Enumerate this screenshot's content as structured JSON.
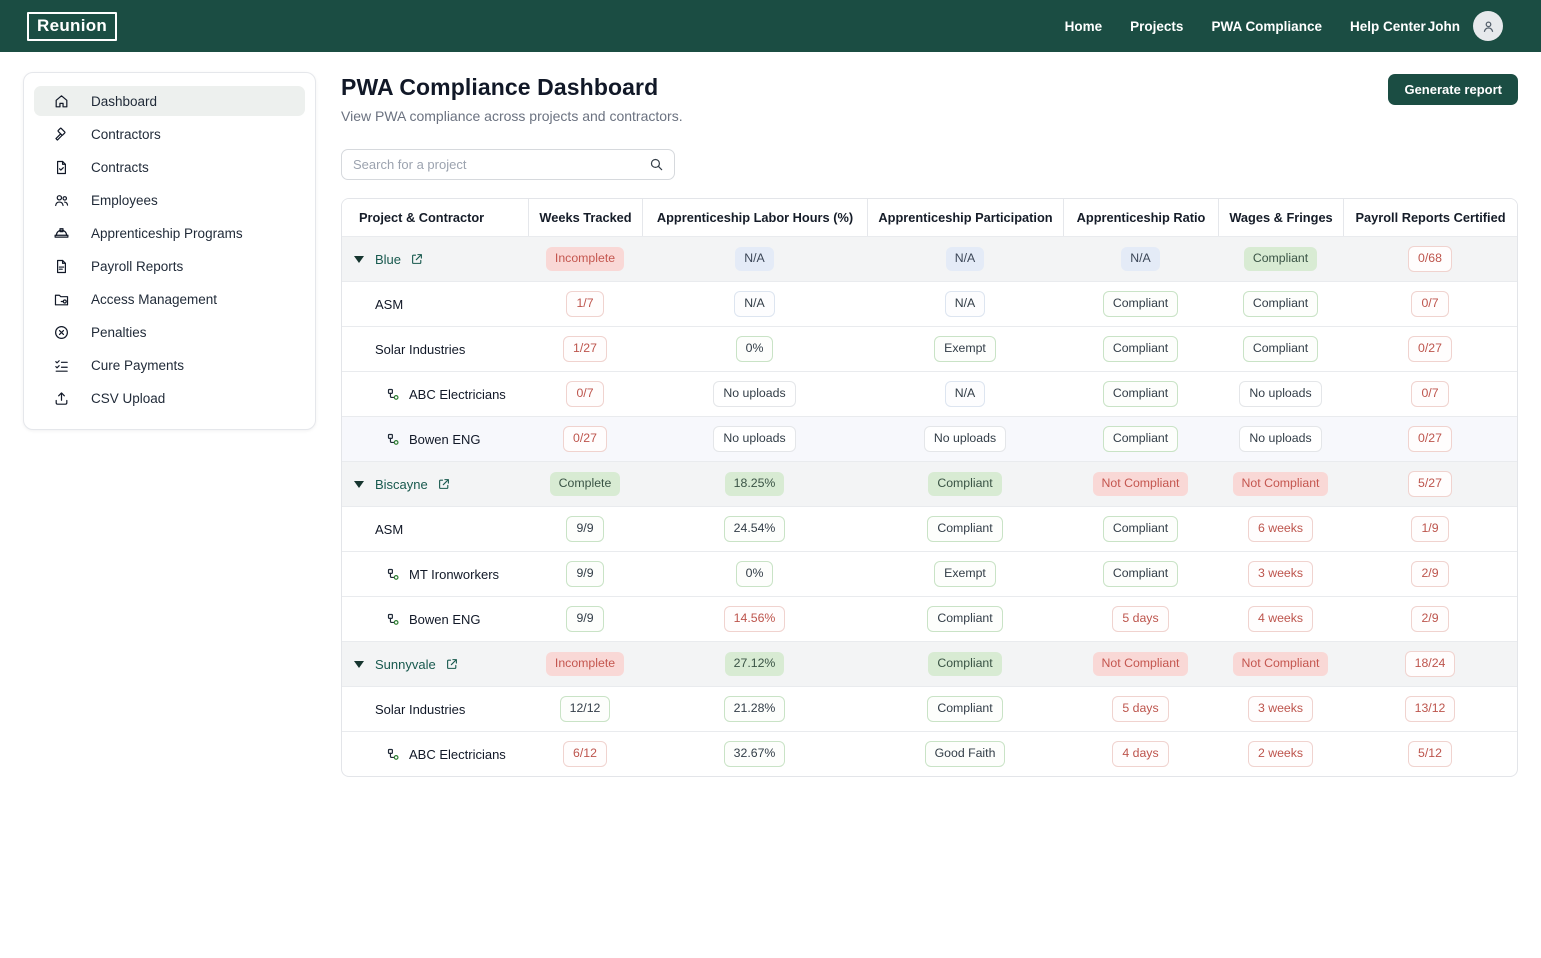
{
  "topbar": {
    "logo": "Reunion",
    "nav": [
      "Home",
      "Projects",
      "PWA Compliance",
      "Help Center"
    ],
    "user": "John"
  },
  "sidebar": {
    "items": [
      {
        "label": "Dashboard",
        "icon": "home-icon",
        "active": true
      },
      {
        "label": "Contractors",
        "icon": "hammer-icon",
        "active": false
      },
      {
        "label": "Contracts",
        "icon": "contract-icon",
        "active": false
      },
      {
        "label": "Employees",
        "icon": "employees-icon",
        "active": false
      },
      {
        "label": "Apprenticeship Programs",
        "icon": "hardhat-icon",
        "active": false
      },
      {
        "label": "Payroll Reports",
        "icon": "payroll-icon",
        "active": false
      },
      {
        "label": "Access Management",
        "icon": "folder-key-icon",
        "active": false
      },
      {
        "label": "Penalties",
        "icon": "penalty-icon",
        "active": false
      },
      {
        "label": "Cure Payments",
        "icon": "checklist-icon",
        "active": false
      },
      {
        "label": "CSV Upload",
        "icon": "upload-icon",
        "active": false
      }
    ]
  },
  "header": {
    "title": "PWA Compliance Dashboard",
    "subtitle": "View PWA compliance across projects and contractors.",
    "generate_report_label": "Generate report",
    "search_placeholder": "Search for a project"
  },
  "table": {
    "columns": [
      "Project & Contractor",
      "Weeks Tracked",
      "Apprenticeship Labor Hours (%)",
      "Apprenticeship Participation",
      "Apprenticeship Ratio",
      "Wages & Fringes",
      "Payroll Reports Certified"
    ],
    "rows": [
      {
        "name": "Blue",
        "level": "project",
        "tint": false,
        "cells": [
          {
            "text": "Incomplete",
            "style": "fill-red"
          },
          {
            "text": "N/A",
            "style": "fill-blue"
          },
          {
            "text": "N/A",
            "style": "fill-blue"
          },
          {
            "text": "N/A",
            "style": "fill-blue"
          },
          {
            "text": "Compliant",
            "style": "fill-green"
          },
          {
            "text": "0/68",
            "style": "pill-red"
          }
        ]
      },
      {
        "name": "ASM",
        "level": "contractor",
        "tint": false,
        "cells": [
          {
            "text": "1/7",
            "style": "pill-red"
          },
          {
            "text": "N/A",
            "style": "pill-blue"
          },
          {
            "text": "N/A",
            "style": "pill-blue"
          },
          {
            "text": "Compliant",
            "style": "pill-green"
          },
          {
            "text": "Compliant",
            "style": "pill-green"
          },
          {
            "text": "0/7",
            "style": "pill-red"
          }
        ]
      },
      {
        "name": "Solar Industries",
        "level": "contractor",
        "tint": false,
        "cells": [
          {
            "text": "1/27",
            "style": "pill-red"
          },
          {
            "text": "0%",
            "style": "pill-green"
          },
          {
            "text": "Exempt",
            "style": "pill-green"
          },
          {
            "text": "Compliant",
            "style": "pill-green"
          },
          {
            "text": "Compliant",
            "style": "pill-green"
          },
          {
            "text": "0/27",
            "style": "pill-red"
          }
        ]
      },
      {
        "name": "ABC Electricians",
        "level": "subcontractor",
        "tint": false,
        "cells": [
          {
            "text": "0/7",
            "style": "pill-red"
          },
          {
            "text": "No uploads",
            "style": "pill-gray"
          },
          {
            "text": "N/A",
            "style": "pill-blue"
          },
          {
            "text": "Compliant",
            "style": "pill-green"
          },
          {
            "text": "No uploads",
            "style": "pill-gray"
          },
          {
            "text": "0/7",
            "style": "pill-red"
          }
        ]
      },
      {
        "name": "Bowen ENG",
        "level": "subcontractor",
        "tint": true,
        "cells": [
          {
            "text": "0/27",
            "style": "pill-red"
          },
          {
            "text": "No uploads",
            "style": "pill-gray"
          },
          {
            "text": "No uploads",
            "style": "pill-gray"
          },
          {
            "text": "Compliant",
            "style": "pill-green"
          },
          {
            "text": "No uploads",
            "style": "pill-gray"
          },
          {
            "text": "0/27",
            "style": "pill-red"
          }
        ]
      },
      {
        "name": "Biscayne",
        "level": "project",
        "tint": false,
        "cells": [
          {
            "text": "Complete",
            "style": "fill-green"
          },
          {
            "text": "18.25%",
            "style": "fill-green"
          },
          {
            "text": "Compliant",
            "style": "fill-green"
          },
          {
            "text": "Not Compliant",
            "style": "fill-red"
          },
          {
            "text": "Not Compliant",
            "style": "fill-red"
          },
          {
            "text": "5/27",
            "style": "pill-red"
          }
        ]
      },
      {
        "name": "ASM",
        "level": "contractor",
        "tint": false,
        "cells": [
          {
            "text": "9/9",
            "style": "pill-green"
          },
          {
            "text": "24.54%",
            "style": "pill-green"
          },
          {
            "text": "Compliant",
            "style": "pill-green"
          },
          {
            "text": "Compliant",
            "style": "pill-green"
          },
          {
            "text": "6 weeks",
            "style": "pill-red"
          },
          {
            "text": "1/9",
            "style": "pill-red"
          }
        ]
      },
      {
        "name": "MT Ironworkers",
        "level": "subcontractor",
        "tint": false,
        "cells": [
          {
            "text": "9/9",
            "style": "pill-green"
          },
          {
            "text": "0%",
            "style": "pill-green"
          },
          {
            "text": "Exempt",
            "style": "pill-green"
          },
          {
            "text": "Compliant",
            "style": "pill-green"
          },
          {
            "text": "3 weeks",
            "style": "pill-red"
          },
          {
            "text": "2/9",
            "style": "pill-red"
          }
        ]
      },
      {
        "name": "Bowen ENG",
        "level": "subcontractor",
        "tint": false,
        "cells": [
          {
            "text": "9/9",
            "style": "pill-green"
          },
          {
            "text": "14.56%",
            "style": "pill-red"
          },
          {
            "text": "Compliant",
            "style": "pill-green"
          },
          {
            "text": "5 days",
            "style": "pill-red"
          },
          {
            "text": "4 weeks",
            "style": "pill-red"
          },
          {
            "text": "2/9",
            "style": "pill-red"
          }
        ]
      },
      {
        "name": "Sunnyvale",
        "level": "project",
        "tint": false,
        "cells": [
          {
            "text": "Incomplete",
            "style": "fill-red"
          },
          {
            "text": "27.12%",
            "style": "fill-green"
          },
          {
            "text": "Compliant",
            "style": "fill-green"
          },
          {
            "text": "Not Compliant",
            "style": "fill-red"
          },
          {
            "text": "Not Compliant",
            "style": "fill-red"
          },
          {
            "text": "18/24",
            "style": "pill-red"
          }
        ]
      },
      {
        "name": "Solar Industries",
        "level": "contractor",
        "tint": false,
        "cells": [
          {
            "text": "12/12",
            "style": "pill-green"
          },
          {
            "text": "21.28%",
            "style": "pill-green"
          },
          {
            "text": "Compliant",
            "style": "pill-green"
          },
          {
            "text": "5 days",
            "style": "pill-red"
          },
          {
            "text": "3 weeks",
            "style": "pill-red"
          },
          {
            "text": "13/12",
            "style": "pill-red"
          }
        ]
      },
      {
        "name": "ABC Electricians",
        "level": "subcontractor",
        "tint": false,
        "cells": [
          {
            "text": "6/12",
            "style": "pill-red"
          },
          {
            "text": "32.67%",
            "style": "pill-green"
          },
          {
            "text": "Good Faith",
            "style": "pill-green"
          },
          {
            "text": "4 days",
            "style": "pill-red"
          },
          {
            "text": "2 weeks",
            "style": "pill-red"
          },
          {
            "text": "5/12",
            "style": "pill-red"
          }
        ]
      }
    ]
  },
  "colors": {
    "brand_green": "#1b4d43",
    "project_link": "#18594e",
    "badge_green_fill": "#d8ebd3",
    "badge_red_fill": "#f9d8d6",
    "badge_blue_fill": "#e4ebf7",
    "badge_red_text": "#bd544c",
    "group_row_bg": "#f3f4f5"
  }
}
